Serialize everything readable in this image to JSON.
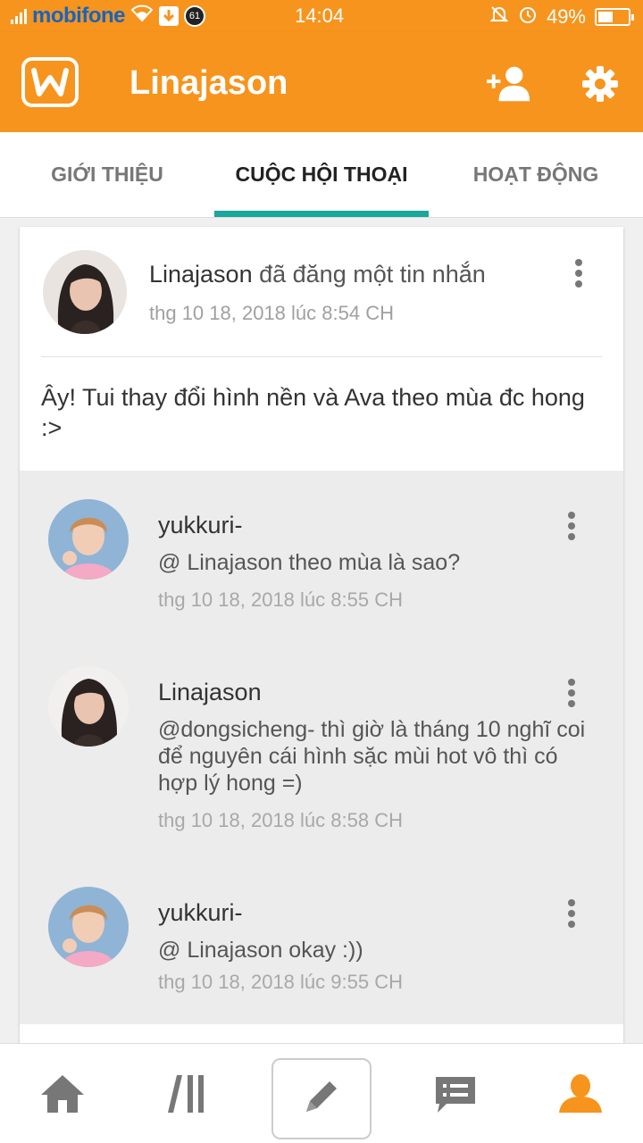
{
  "status_bar": {
    "carrier": "mobifone",
    "time": "14:04",
    "battery_text": "49%",
    "battery_level": 0.49,
    "notification_count": "61"
  },
  "app_bar": {
    "title": "Linajason",
    "logo_icon": "wattpad-logo-icon",
    "add_user_icon": "add-user-icon",
    "settings_icon": "gear-icon",
    "color": "#f7941d"
  },
  "tabs": [
    {
      "label": "GIỚI THIỆU",
      "active": false
    },
    {
      "label": "CUỘC HỘI THOẠI",
      "active": true
    },
    {
      "label": "HOẠT ĐỘNG",
      "active": false
    }
  ],
  "accent_color": "#1aa79c",
  "post": {
    "author": "Linajason",
    "action": "đã đăng một tin nhắn",
    "time": "thg 10 18, 2018 lúc 8:54 CH",
    "body": "Ây! Tui thay đổi hình nền và Ava theo mùa đc hong :>"
  },
  "replies": [
    {
      "author": "yukkuri-",
      "text": "@ Linajason  theo mùa là sao?",
      "time": "thg 10 18, 2018 lúc 8:55 CH"
    },
    {
      "author": "Linajason",
      "text": "@dongsicheng- thì giờ là tháng 10 nghĩ coi để nguyên cái hình sặc mùi hot vô thì có hợp lý hong =)",
      "time": "thg 10 18, 2018 lúc 8:58 CH"
    },
    {
      "author": "yukkuri-",
      "text": "@ Linajason  okay :))",
      "time": "thg 10 18, 2018 lúc 9:55 CH"
    }
  ],
  "bottom_nav": [
    {
      "icon": "home-icon"
    },
    {
      "icon": "library-icon"
    },
    {
      "icon": "pencil-icon"
    },
    {
      "icon": "messages-icon"
    },
    {
      "icon": "profile-icon",
      "active": true
    }
  ]
}
